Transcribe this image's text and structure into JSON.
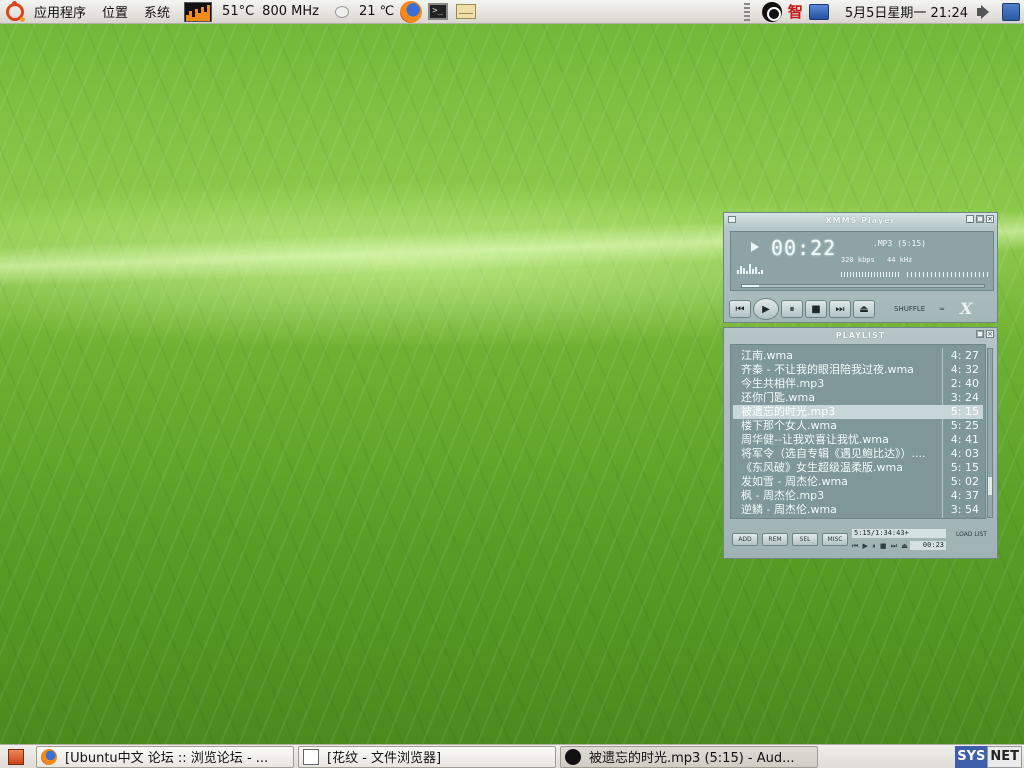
{
  "top_panel": {
    "menus": [
      "应用程序",
      "位置",
      "系统"
    ],
    "cpu_temp": "51°C",
    "cpu_freq": "800 MHz",
    "weather_temp": "21 ℃",
    "clock": "5月5日星期一 21:24",
    "ime_label": "智"
  },
  "xmms": {
    "window_title": "XMMS Player",
    "time": "00:22",
    "song_title": ".MP3 (5:15)",
    "bitrate": "320 kbps",
    "samplerate": "44 kHz",
    "seek_progress": 0.07,
    "shuffle_label": "SHUFFLE",
    "repeat_label": "≈",
    "logo": "X",
    "controls": {
      "prev": "⏮",
      "play": "▶",
      "pause": "⏸",
      "stop": "■",
      "next": "⏭",
      "eject": "⏏"
    }
  },
  "playlist": {
    "title": "PLAYLIST",
    "selected_index": 4,
    "items": [
      {
        "name": "江南.wma",
        "duration": "4: 27"
      },
      {
        "name": "齐秦 - 不让我的眼泪陪我过夜.wma",
        "duration": "4: 32"
      },
      {
        "name": "今生共相伴.mp3",
        "duration": "2: 40"
      },
      {
        "name": "还你门匙.wma",
        "duration": "3: 24"
      },
      {
        "name": "被遗忘的时光.mp3",
        "duration": "5: 15"
      },
      {
        "name": "楼下那个女人.wma",
        "duration": "5: 25"
      },
      {
        "name": "周华健--让我欢喜让我忧.wma",
        "duration": "4: 41"
      },
      {
        "name": "将军令（选自专辑《遇见鲍比达》）....",
        "duration": "4: 03"
      },
      {
        "name": "《东风破》女生超级温柔版.wma",
        "duration": "5: 15"
      },
      {
        "name": "发如雪 - 周杰伦.wma",
        "duration": "5: 02"
      },
      {
        "name": "枫 - 周杰伦.mp3",
        "duration": "4: 37"
      },
      {
        "name": "逆鳞 - 周杰伦.wma",
        "duration": "3: 54"
      }
    ],
    "buttons": [
      "ADD",
      "REM",
      "SEL",
      "MISC"
    ],
    "info": "5:15/1:34:43+",
    "mini_controls": "⏮ ▶ ⏸ ■ ⏭ ⏏",
    "mini_time": "00:23",
    "load_list": "LOAD LIST"
  },
  "taskbar": {
    "tasks": [
      {
        "label": "[Ubuntu中文 论坛 :: 浏览论坛 - ...",
        "icon": "firefox-icon"
      },
      {
        "label": "[花纹 - 文件浏览器]",
        "icon": "file-manager-icon"
      },
      {
        "label": "被遗忘的时光.mp3 (5:15) - Aud...",
        "icon": "audacious-icon"
      }
    ],
    "sys_label": "SYS",
    "net_label": "NET"
  }
}
